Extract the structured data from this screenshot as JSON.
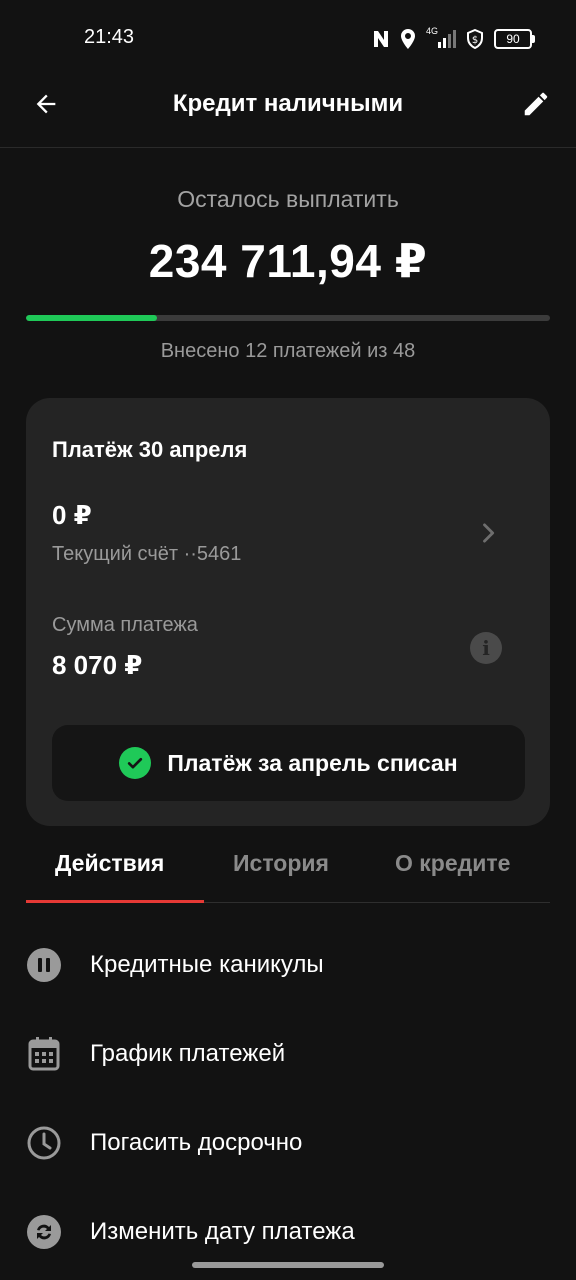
{
  "status_bar": {
    "time": "21:43",
    "network": "4G",
    "battery": "90"
  },
  "header": {
    "title": "Кредит наличными"
  },
  "summary": {
    "remaining_label": "Осталось выплатить",
    "remaining_amount": "234 711,94 ₽",
    "progress_caption": "Внесено 12 платежей из 48",
    "payments_made": 12,
    "payments_total": 48,
    "progress_color": "#1fc958"
  },
  "payment_card": {
    "title": "Платёж 30 апреля",
    "account_amount": "0 ₽",
    "account_name": "Текущий счёт ··5461",
    "sum_label": "Сумма платежа",
    "sum_value": "8 070 ₽",
    "status_text": "Платёж за апрель списан"
  },
  "tabs": [
    {
      "label": "Действия",
      "active": true
    },
    {
      "label": "История",
      "active": false
    },
    {
      "label": "О кредите",
      "active": false
    }
  ],
  "actions": [
    {
      "label": "Кредитные каникулы",
      "icon": "pause-icon"
    },
    {
      "label": "График платежей",
      "icon": "calendar-icon"
    },
    {
      "label": "Погасить досрочно",
      "icon": "clock-icon"
    },
    {
      "label": "Изменить дату платежа",
      "icon": "refresh-icon"
    }
  ],
  "colors": {
    "accent_green": "#1fc958",
    "tab_indicator": "#e53935",
    "background": "#121212",
    "card": "#242424"
  }
}
